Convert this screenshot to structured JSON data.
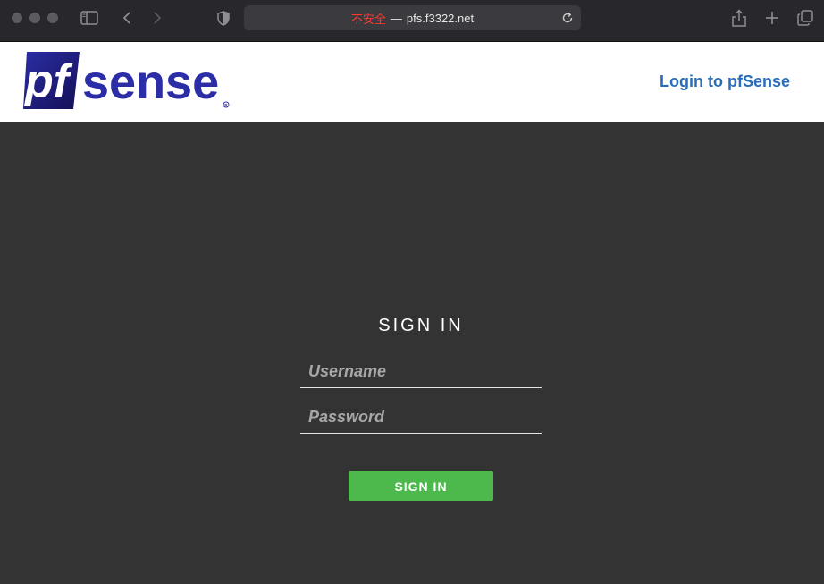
{
  "browser": {
    "security_label": "不安全",
    "separator": "—",
    "url": "pfs.f3322.net"
  },
  "header": {
    "logo_alt": "pfsense",
    "logo_text_pf": "pf",
    "logo_text_sense": "sense",
    "title": "Login to pfSense"
  },
  "login": {
    "heading": "SIGN IN",
    "username_placeholder": "Username",
    "password_placeholder": "Password",
    "submit_label": "SIGN IN"
  },
  "colors": {
    "brand_blue": "#2b2ea6",
    "brand_dark": "#1a1466",
    "header_link": "#2a6ebb",
    "page_bg": "#333333",
    "button_green": "#4db94c"
  }
}
